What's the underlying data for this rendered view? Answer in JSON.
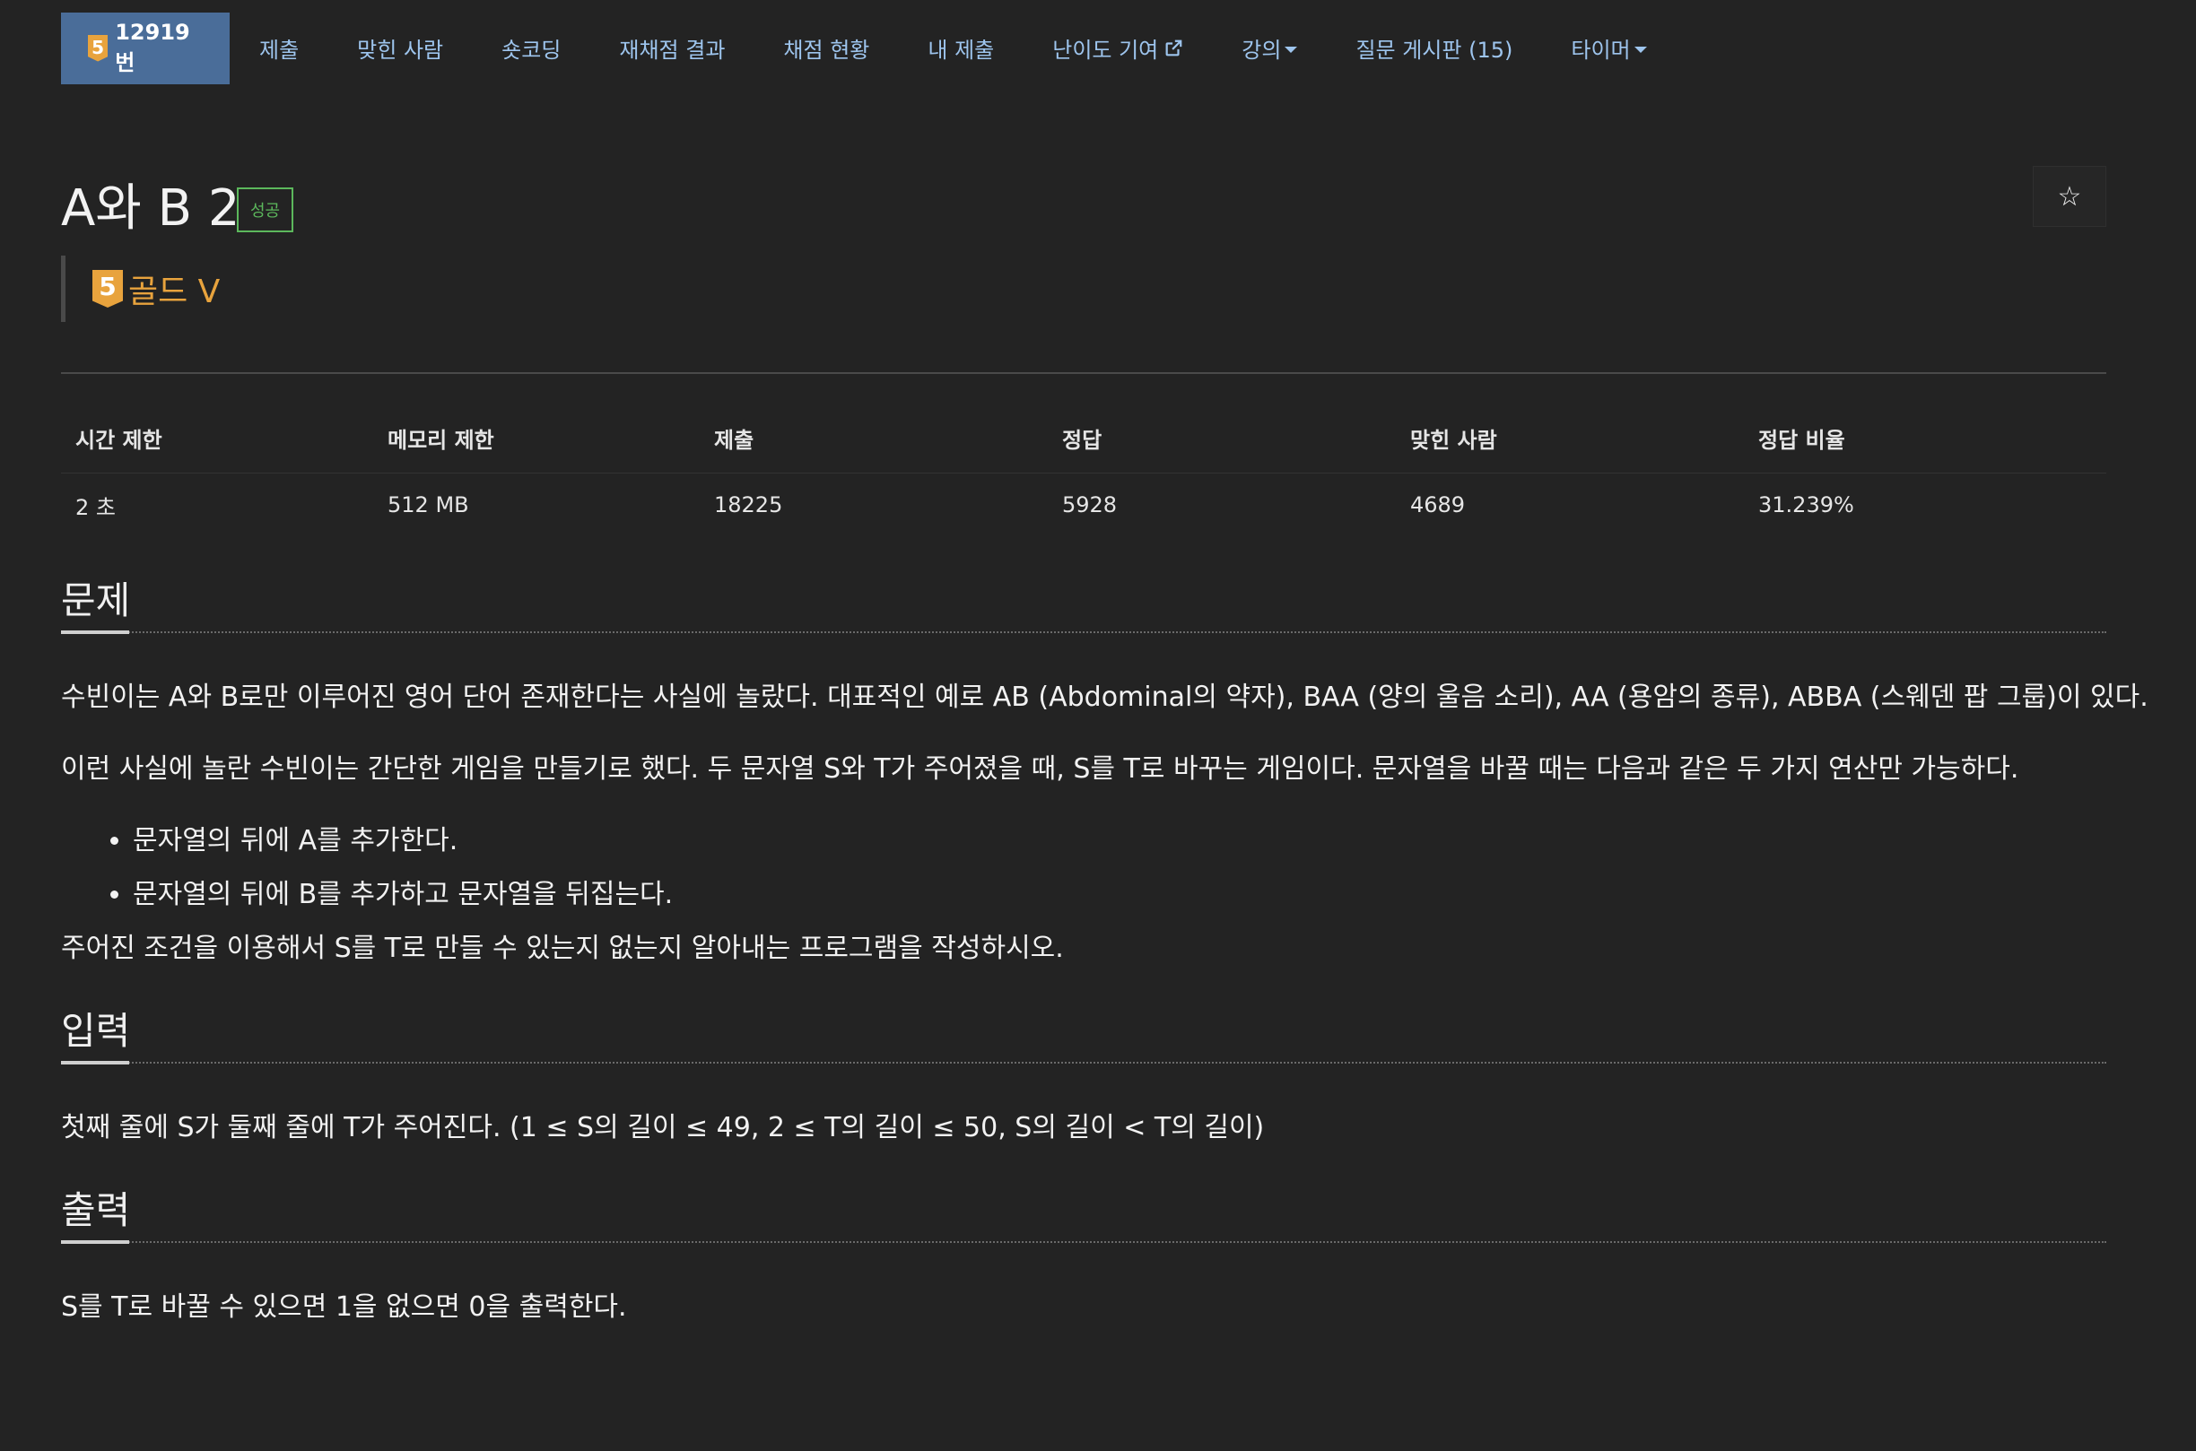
{
  "nav": {
    "problem_tier": "5",
    "problem_number": "12919번",
    "items": [
      {
        "label": "제출"
      },
      {
        "label": "맞힌 사람"
      },
      {
        "label": "숏코딩"
      },
      {
        "label": "재채점 결과"
      },
      {
        "label": "채점 현황"
      },
      {
        "label": "내 제출"
      },
      {
        "label": "난이도 기여"
      },
      {
        "label": "강의"
      },
      {
        "label": "질문 게시판 (15)"
      },
      {
        "label": "타이머"
      }
    ]
  },
  "problem": {
    "title": "A와 B 2",
    "status_label": "성공",
    "star_icon": "☆",
    "tier_badge": "5",
    "tier_name": "골드 V"
  },
  "stats": {
    "headers": [
      "시간 제한",
      "메모리 제한",
      "제출",
      "정답",
      "맞힌 사람",
      "정답 비율"
    ],
    "values": [
      "2 초",
      "512 MB",
      "18225",
      "5928",
      "4689",
      "31.239%"
    ]
  },
  "sections": {
    "description": {
      "title": "문제",
      "p1": "수빈이는 A와 B로만 이루어진 영어 단어 존재한다는 사실에 놀랐다. 대표적인 예로 AB (Abdominal의 약자), BAA (양의 울음 소리), AA (용암의 종류), ABBA (스웨덴 팝 그룹)이 있다.",
      "p2": "이런 사실에 놀란 수빈이는 간단한 게임을 만들기로 했다. 두 문자열 S와 T가 주어졌을 때, S를 T로 바꾸는 게임이다. 문자열을 바꿀 때는 다음과 같은 두 가지 연산만 가능하다.",
      "bullets": [
        "문자열의 뒤에 A를 추가한다.",
        "문자열의 뒤에 B를 추가하고 문자열을 뒤집는다."
      ],
      "p3": "주어진 조건을 이용해서 S를 T로 만들 수 있는지 없는지 알아내는 프로그램을 작성하시오."
    },
    "input": {
      "title": "입력",
      "text": "첫째 줄에 S가 둘째 줄에 T가 주어진다. (1 ≤ S의 길이 ≤ 49, 2 ≤ T의 길이 ≤ 50, S의 길이 < T의 길이)"
    },
    "output": {
      "title": "출력",
      "text": "S를 T로 바꿀 수 있으면 1을 없으면 0을 출력한다."
    }
  },
  "colors": {
    "background": "#232323",
    "nav_active": "#4a6d99",
    "link": "#9ec5ee",
    "gold": "#e8a33d",
    "success": "#5cb85c"
  }
}
